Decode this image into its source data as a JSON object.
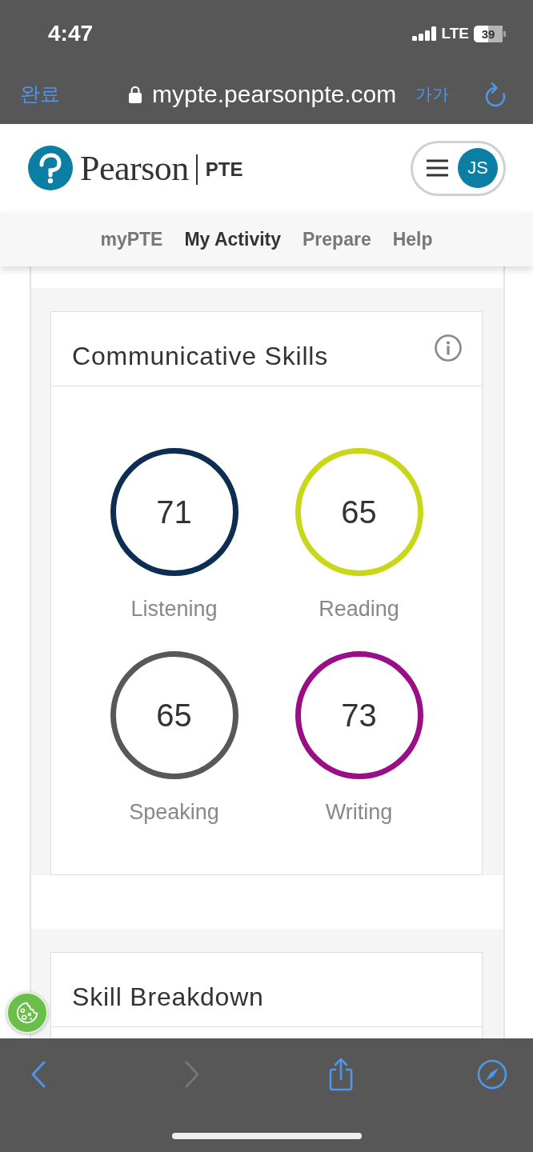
{
  "status_bar": {
    "time": "4:47",
    "network": "LTE",
    "battery": "39"
  },
  "browser_bar": {
    "done": "완료",
    "url": "mypte.pearsonpte.com",
    "text_size": "가가"
  },
  "header": {
    "brand": "Pearson",
    "product": "PTE",
    "avatar_initials": "JS"
  },
  "nav": [
    {
      "label": "myPTE",
      "selected": false
    },
    {
      "label": "My Activity",
      "selected": true
    },
    {
      "label": "Prepare",
      "selected": false
    },
    {
      "label": "Help",
      "selected": false
    }
  ],
  "communicative_skills": {
    "title": "Communicative Skills",
    "skills": [
      {
        "score": "71",
        "label": "Listening",
        "color": "#0e2d53"
      },
      {
        "score": "65",
        "label": "Reading",
        "color": "#c9d719"
      },
      {
        "score": "65",
        "label": "Speaking",
        "color": "#58585a"
      },
      {
        "score": "73",
        "label": "Writing",
        "color": "#9a0e86"
      }
    ]
  },
  "skill_breakdown": {
    "title": "Skill Breakdown"
  },
  "toolbar": [
    {
      "kind": "back",
      "disabled": false
    },
    {
      "kind": "forward",
      "disabled": true
    },
    {
      "kind": "share",
      "disabled": false
    },
    {
      "kind": "compass",
      "disabled": false
    }
  ]
}
